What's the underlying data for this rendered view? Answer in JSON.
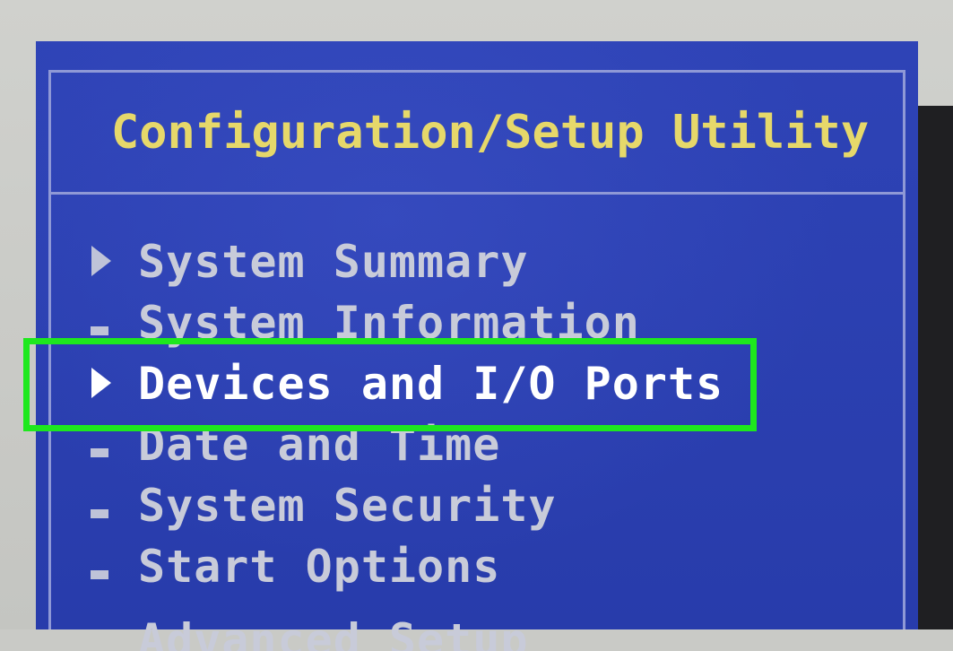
{
  "title": "Configuration/Setup Utility",
  "menu": {
    "items": [
      {
        "label": "System Summary",
        "marker": "triangle",
        "selected": false
      },
      {
        "label": "System Information",
        "marker": "square",
        "selected": false
      },
      {
        "label": "Devices and I/O Ports",
        "marker": "triangle",
        "selected": true
      },
      {
        "label": "Date and Time",
        "marker": "square",
        "selected": false
      },
      {
        "label": "System Security",
        "marker": "square",
        "selected": false
      },
      {
        "label": "Start Options",
        "marker": "square",
        "selected": false
      },
      {
        "label": "Advanced Setup",
        "marker": "none",
        "selected": false
      }
    ]
  },
  "colors": {
    "background": "#2b3fb0",
    "title_text": "#e6d86a",
    "menu_text": "#c8cbd9",
    "selected_text": "#ffffff",
    "highlight": "#1ee81e"
  },
  "icons": {
    "submenu": "triangle-right-icon",
    "item": "square-bullet-icon"
  }
}
